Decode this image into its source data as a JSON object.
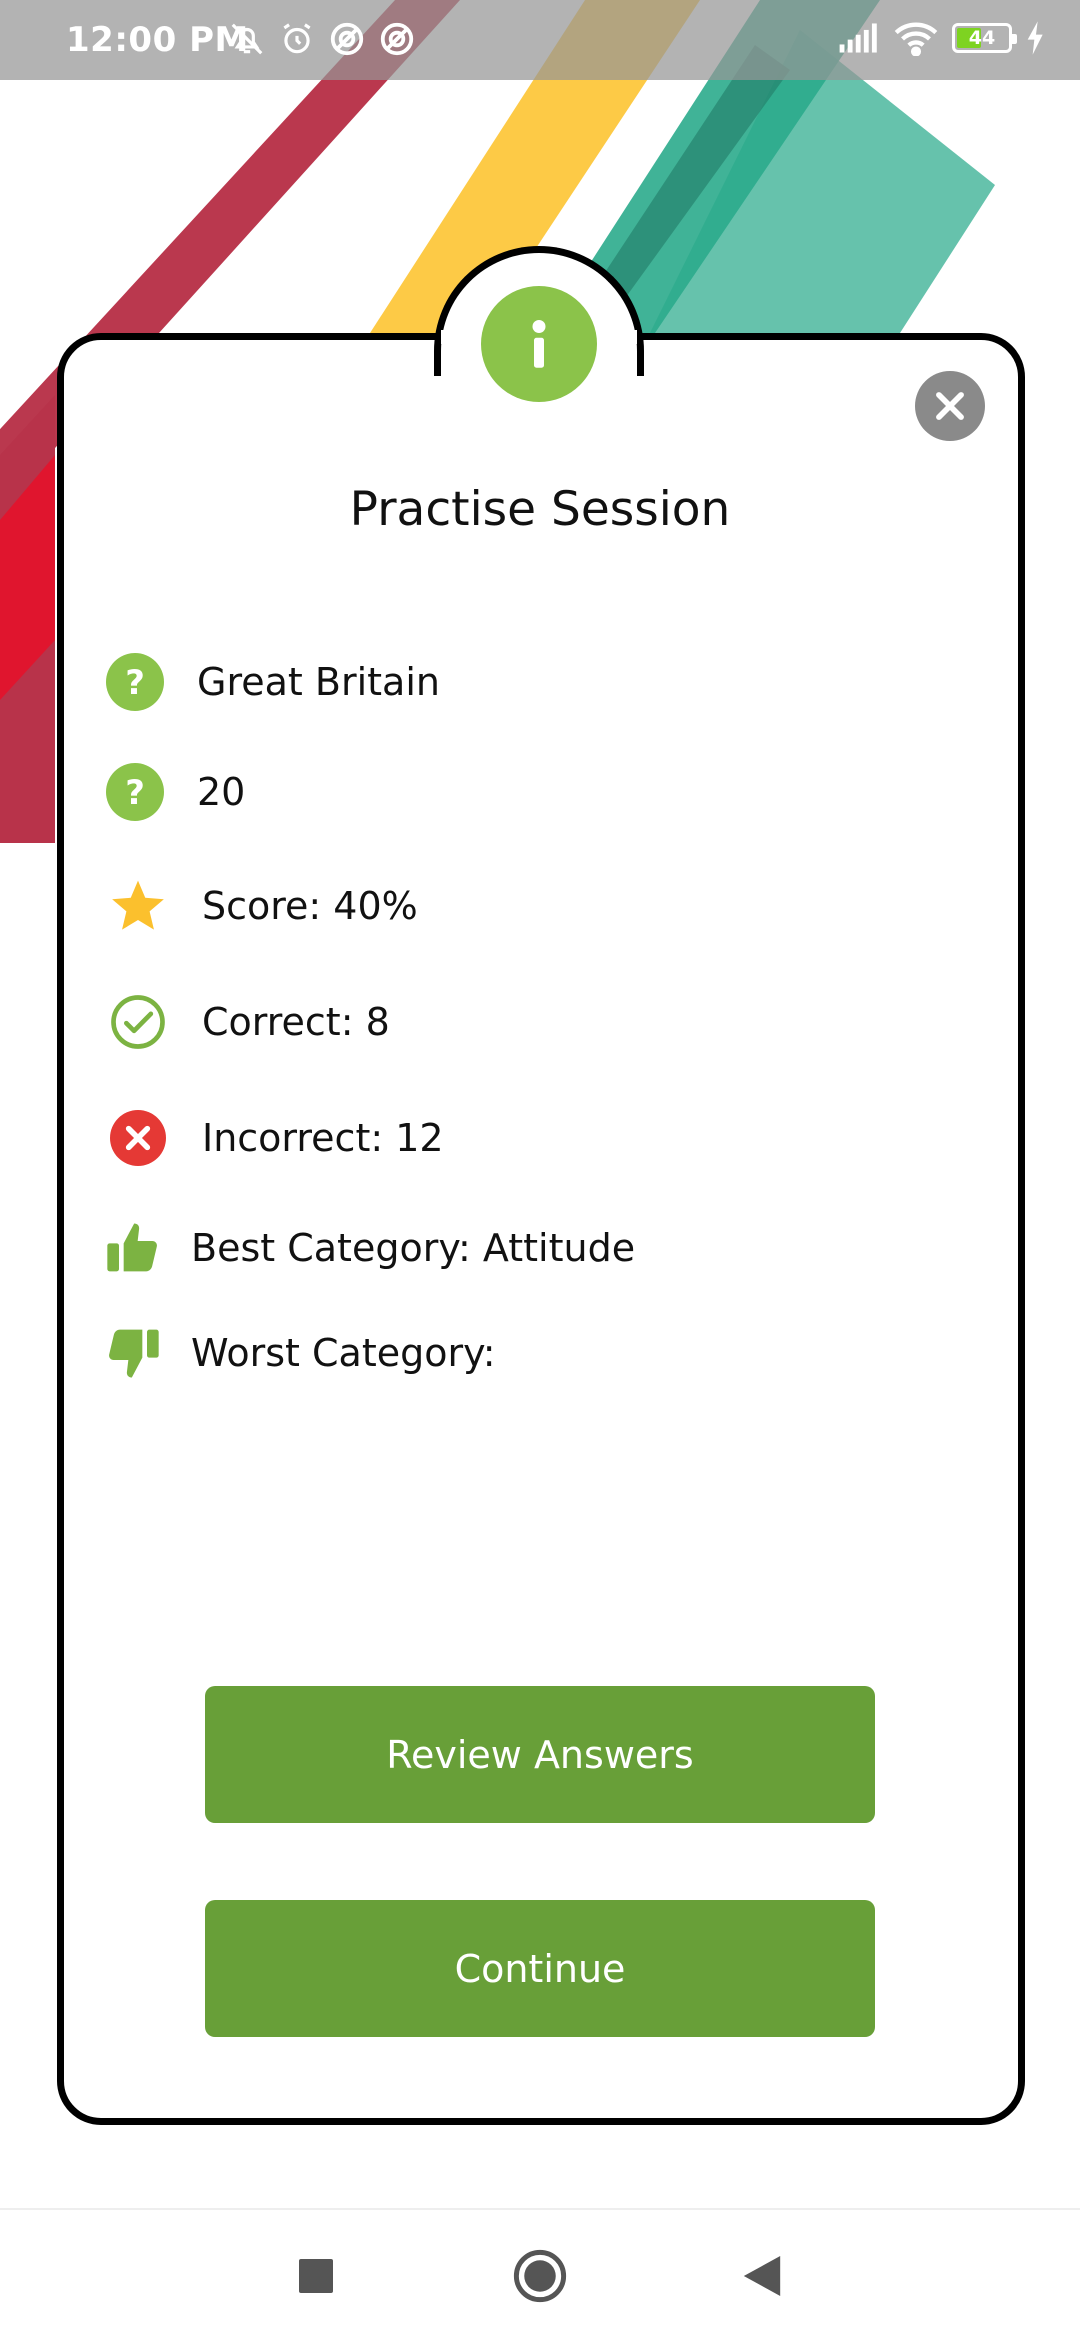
{
  "status_bar": {
    "time": "12:00 PM",
    "battery_level": "44",
    "icons": [
      "notifications-off-icon",
      "alarm-icon",
      "data-saver-icon",
      "data-saver-icon",
      "signal-icon",
      "wifi-icon",
      "battery-icon",
      "charging-icon"
    ]
  },
  "modal": {
    "badge_icon": "info-icon",
    "close_icon": "close-icon",
    "title": "Practise Session",
    "rows": [
      {
        "icon": "question-icon",
        "text": "Great Britain"
      },
      {
        "icon": "question-icon",
        "text": "20"
      },
      {
        "icon": "star-icon",
        "text": "Score: 40%"
      },
      {
        "icon": "check-circle-icon",
        "text": "Correct: 8"
      },
      {
        "icon": "x-circle-icon",
        "text": "Incorrect: 12"
      },
      {
        "icon": "thumbs-up-icon",
        "text": "Best Category: Attitude"
      },
      {
        "icon": "thumbs-down-icon",
        "text": "Worst Category:"
      }
    ],
    "buttons": {
      "review": "Review Answers",
      "continue": "Continue"
    }
  },
  "colors": {
    "accent_green": "#8bc34a",
    "button_green": "#689f38",
    "star_yellow": "#fbc02d",
    "incorrect_red": "#e53935",
    "stripe_red": "#b4273f",
    "stripe_yellow": "#fdc73c",
    "stripe_teal": "#2bab8c"
  },
  "nav_bar": {
    "icons": [
      "recents-square-icon",
      "home-circle-icon",
      "back-triangle-icon"
    ]
  }
}
